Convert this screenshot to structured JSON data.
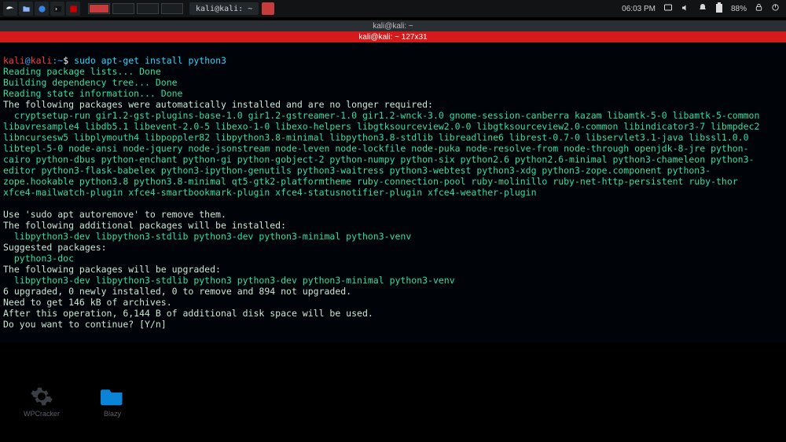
{
  "panel": {
    "workspace_count": 4,
    "active_workspace": 0,
    "task_label_1": "kali@kali: ~",
    "clock": "06:03 PM",
    "battery": "88%"
  },
  "window": {
    "tab_title": "kali@kali: ~",
    "title": "kali@kali: ~ 127x31"
  },
  "prompt": {
    "user": "kali",
    "at": "@",
    "host": "kali",
    "path": ":~",
    "sep": "$ "
  },
  "command": "sudo apt-get install python3",
  "output": {
    "l1": "Reading package lists... Done",
    "l2": "Building dependency tree... Done",
    "l3": "Reading state information... Done",
    "l4": "The following packages were automatically installed and are no longer required:",
    "auto": "  cryptsetup-run gir1.2-gst-plugins-base-1.0 gir1.2-gstreamer-1.0 gir1.2-wnck-3.0 gnome-session-canberra kazam libamtk-5-0 libamtk-5-common libavresample4 libdb5.1 libevent-2.0-5 libexo-1-0 libexo-helpers libgtksourceview2.0-0 libgtksourceview2.0-common libindicator3-7 libmpdec2 libncursesw5 libplymouth4 libpoppler82 libpython3.8-minimal libpython3.8-stdlib libreadline6 librest-0.7-0 libservlet3.1-java libssl1.0.0 libtepl-5-0 node-ansi node-jquery node-jsonstream node-leven node-lockfile node-puka node-resolve-from node-through openjdk-8-jre python-cairo python-dbus python-enchant python-gi python-gobject-2 python-numpy python-six python2.6 python2.6-minimal python3-chameleon python3-editor python3-flask-babelex python3-ipython-genutils python3-waitress python3-webtest python3-xdg python3-zope.component python3-zope.hookable python3.8 python3.8-minimal qt5-gtk2-platformtheme ruby-connection-pool ruby-molinillo ruby-net-http-persistent ruby-thor xfce4-mailwatch-plugin xfce4-smartbookmark-plugin xfce4-statusnotifier-plugin xfce4-weather-plugin",
    "l5": "Use 'sudo apt autoremove' to remove them.",
    "l6": "The following additional packages will be installed:",
    "add": "  libpython3-dev libpython3-stdlib python3-dev python3-minimal python3-venv",
    "l7": "Suggested packages:",
    "sug": "  python3-doc",
    "l8": "The following packages will be upgraded:",
    "upg": "  libpython3-dev libpython3-stdlib python3 python3-dev python3-minimal python3-venv",
    "l9": "6 upgraded, 0 newly installed, 0 to remove and 894 not upgraded.",
    "l10": "Need to get 146 kB of archives.",
    "l11": "After this operation, 6,144 B of additional disk space will be used.",
    "l12": "Do you want to continue? [Y/n]"
  },
  "desktop": {
    "icon1": "WPCracker",
    "icon2": "Blazy"
  }
}
